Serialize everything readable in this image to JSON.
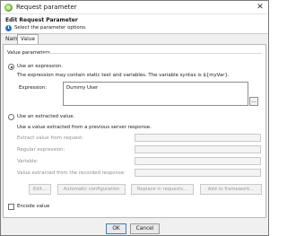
{
  "window": {
    "title": "Request parameter",
    "close_glyph": "✕"
  },
  "header": {
    "title": "Edit Request Parameter",
    "description": "Select the parameter options.",
    "info_icon_glyph": "i"
  },
  "tabs": [
    {
      "label": "Name",
      "active": false
    },
    {
      "label": "Value",
      "active": true
    }
  ],
  "value_parameters": {
    "group_title": "Value parameters",
    "use_expression": {
      "label": "Use an expression.",
      "selected": true,
      "hint": "The expression may contain static text and variables. The variable syntax is ${myVar}.",
      "expression_label": "Expression:",
      "expression_value": "Dummy User",
      "browse_label": "..."
    },
    "use_extracted": {
      "label": "Use an extracted value.",
      "selected": false,
      "hint": "Use a value extracted from a previous server response.",
      "fields": [
        {
          "label": "Extract value from request:",
          "value": ""
        },
        {
          "label": "Regular expression:",
          "value": ""
        },
        {
          "label": "Variable:",
          "value": ""
        },
        {
          "label": "Value extracted from the recorded response:",
          "value": ""
        }
      ],
      "buttons": {
        "edit": "Edit...",
        "auto_config": "Automatic configuration",
        "replace": "Replace in requests...",
        "add_framework": "Add to framework..."
      }
    }
  },
  "encode_value": {
    "label": "Encode value",
    "checked": false
  },
  "footer": {
    "ok": "OK",
    "cancel": "Cancel"
  },
  "colors": {
    "accent": "#3a7bd5",
    "info_icon": "#2d6fc2",
    "app_icon": "#4f9a20"
  }
}
